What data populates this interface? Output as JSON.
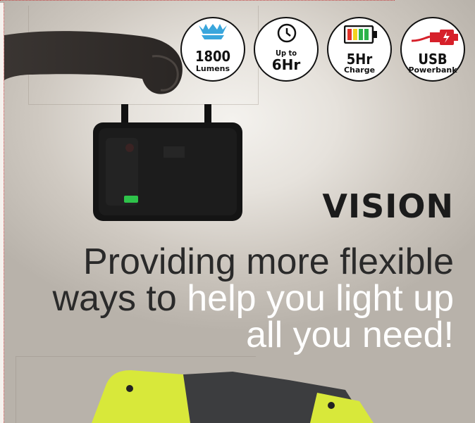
{
  "badges": [
    {
      "id": "lumens",
      "top": "1800",
      "sub": "Lumens",
      "icon": "sun-icon"
    },
    {
      "id": "runtime",
      "top": "Up to",
      "sub": "6Hr",
      "icon": "clock-icon"
    },
    {
      "id": "charge",
      "top": "5Hr",
      "sub": "Charge",
      "icon": "battery-icon"
    },
    {
      "id": "usb",
      "top": "USB",
      "sub": "Powerbank",
      "icon": "usb-plug-icon"
    }
  ],
  "title": "VISION",
  "headline": {
    "line1": "Providing more flexible",
    "line2_dark": "ways to",
    "line2_light": " help you light up",
    "line3": "all you need!"
  },
  "colors": {
    "sun": "#3aa6dc",
    "battery_green": "#2db34a",
    "battery_yellow": "#f2d21e",
    "battery_red": "#e2332a",
    "usb_red": "#d6202a",
    "lamp_yellow": "#d8e83a"
  }
}
